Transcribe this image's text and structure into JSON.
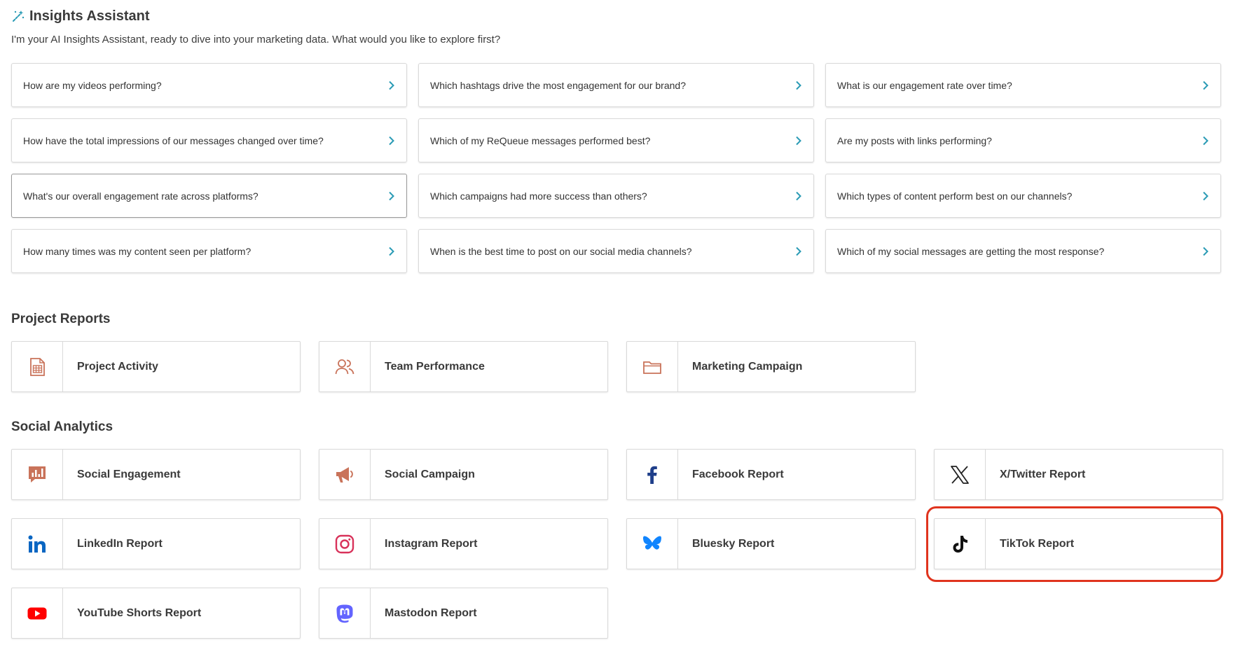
{
  "header": {
    "title": "Insights Assistant",
    "intro": "I'm your AI Insights Assistant, ready to dive into your marketing data. What would you like to explore first?"
  },
  "prompts": [
    "How are my videos performing?",
    "Which hashtags drive the most engagement for our brand?",
    "What is our engagement rate over time?",
    "How have the total impressions of our messages changed over time?",
    "Which of my ReQueue messages performed best?",
    "Are my posts with links performing?",
    "What's our overall engagement rate across platforms?",
    "Which campaigns had more success than others?",
    "Which types of content perform best on our channels?",
    "How many times was my content seen per platform?",
    "When is the best time to post on our social media channels?",
    "Which of my social messages are getting the most response?"
  ],
  "project_reports": {
    "title": "Project Reports",
    "items": [
      {
        "label": "Project Activity",
        "icon": "spreadsheet-icon"
      },
      {
        "label": "Team Performance",
        "icon": "users-icon"
      },
      {
        "label": "Marketing Campaign",
        "icon": "folder-icon"
      }
    ]
  },
  "social_analytics": {
    "title": "Social Analytics",
    "items": [
      {
        "label": "Social Engagement",
        "icon": "chart-bubble-icon"
      },
      {
        "label": "Social Campaign",
        "icon": "megaphone-icon"
      },
      {
        "label": "Facebook Report",
        "icon": "facebook-icon"
      },
      {
        "label": "X/Twitter Report",
        "icon": "x-twitter-icon"
      },
      {
        "label": "LinkedIn Report",
        "icon": "linkedin-icon"
      },
      {
        "label": "Instagram Report",
        "icon": "instagram-icon"
      },
      {
        "label": "Bluesky Report",
        "icon": "bluesky-icon"
      },
      {
        "label": "TikTok Report",
        "icon": "tiktok-icon"
      },
      {
        "label": "YouTube Shorts Report",
        "icon": "youtube-icon"
      },
      {
        "label": "Mastodon Report",
        "icon": "mastodon-icon"
      }
    ]
  },
  "colors": {
    "accent": "#2a9bb5",
    "icon_orange": "#c9735a",
    "facebook": "#1f3f8a",
    "linkedin": "#0a66c2",
    "instagram": "#d8325a",
    "bluesky": "#1185fe",
    "youtube": "#ff0000",
    "mastodon": "#6364ff",
    "highlight": "#e0341e"
  }
}
